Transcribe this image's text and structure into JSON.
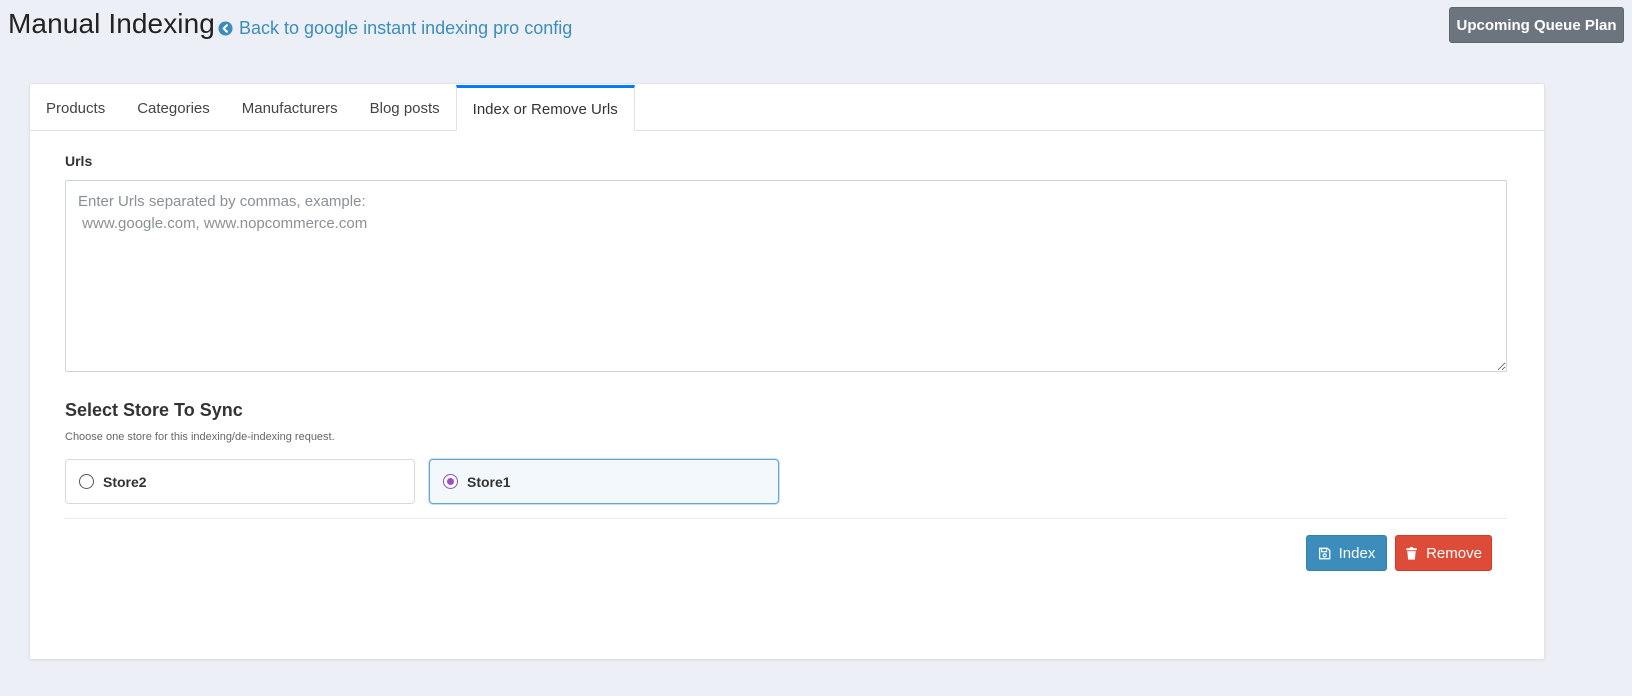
{
  "header": {
    "title": "Manual Indexing",
    "back_link": "Back to google instant indexing pro config",
    "queue_button": "Upcoming Queue Plan"
  },
  "tabs": [
    {
      "label": "Products",
      "active": false
    },
    {
      "label": "Categories",
      "active": false
    },
    {
      "label": "Manufacturers",
      "active": false
    },
    {
      "label": "Blog posts",
      "active": false
    },
    {
      "label": "Index or Remove Urls",
      "active": true
    }
  ],
  "form": {
    "urls_label": "Urls",
    "urls_value": "",
    "urls_placeholder": "Enter Urls separated by commas, example:\n www.google.com, www.nopcommerce.com",
    "store_heading": "Select Store To Sync",
    "store_help": "Choose one store for this indexing/de-indexing request.",
    "stores": [
      {
        "label": "Store2",
        "selected": false
      },
      {
        "label": "Store1",
        "selected": true
      }
    ]
  },
  "actions": {
    "index_label": "Index",
    "remove_label": "Remove"
  },
  "colors": {
    "accent_tab": "#007bff",
    "link": "#3c8dbc",
    "index_button": "#3c8dbc",
    "remove_button": "#dd4b39",
    "queue_button": "#6c757d",
    "radio_checked": "#9c4fc4"
  },
  "icons": {
    "back": "arrow-circle-left-icon",
    "index": "save-icon",
    "remove": "trash-icon"
  }
}
